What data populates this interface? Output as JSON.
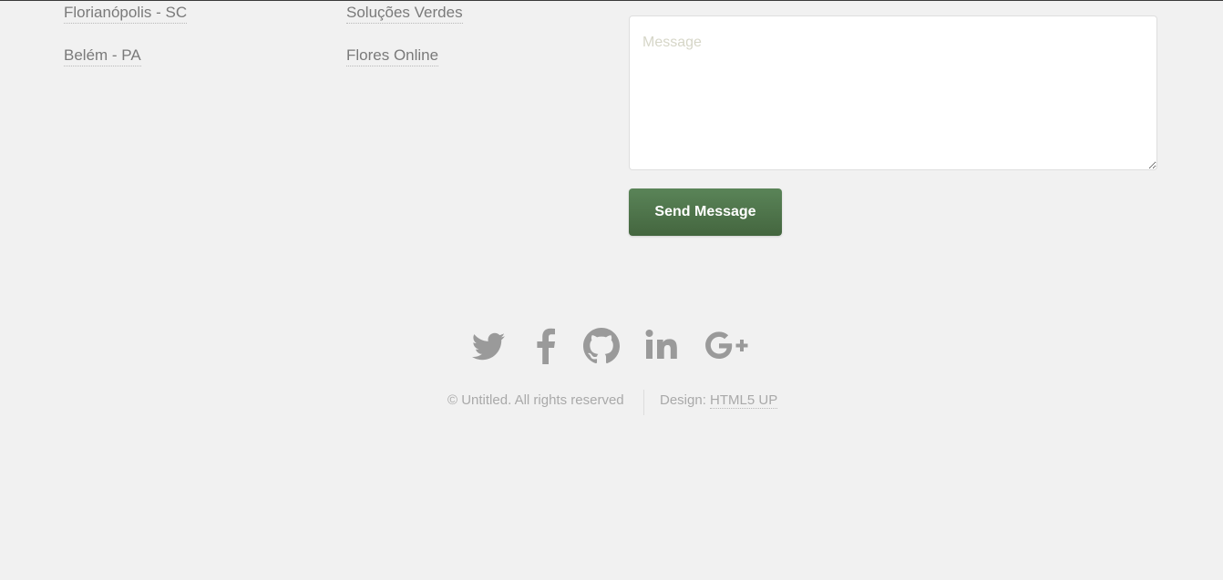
{
  "links": {
    "left_column": [
      "Florianópolis - SC",
      "Belém - PA"
    ],
    "middle_column": [
      "Soluções Verdes",
      "Flores Online"
    ]
  },
  "contact_form": {
    "message_placeholder": "Message",
    "message_value": "",
    "send_label": "Send Message"
  },
  "social": [
    {
      "icon": "twitter-icon"
    },
    {
      "icon": "facebook-icon"
    },
    {
      "icon": "github-icon"
    },
    {
      "icon": "linkedin-icon"
    },
    {
      "icon": "google-plus-icon"
    }
  ],
  "footer": {
    "copyright": "© Untitled. All rights reserved",
    "design_prefix": "Design:",
    "design_link": "HTML5 UP"
  },
  "colors": {
    "background": "#f1f1f1",
    "button": "#4f7549",
    "text": "#7a7a7a",
    "icon": "#9a9a9a"
  }
}
